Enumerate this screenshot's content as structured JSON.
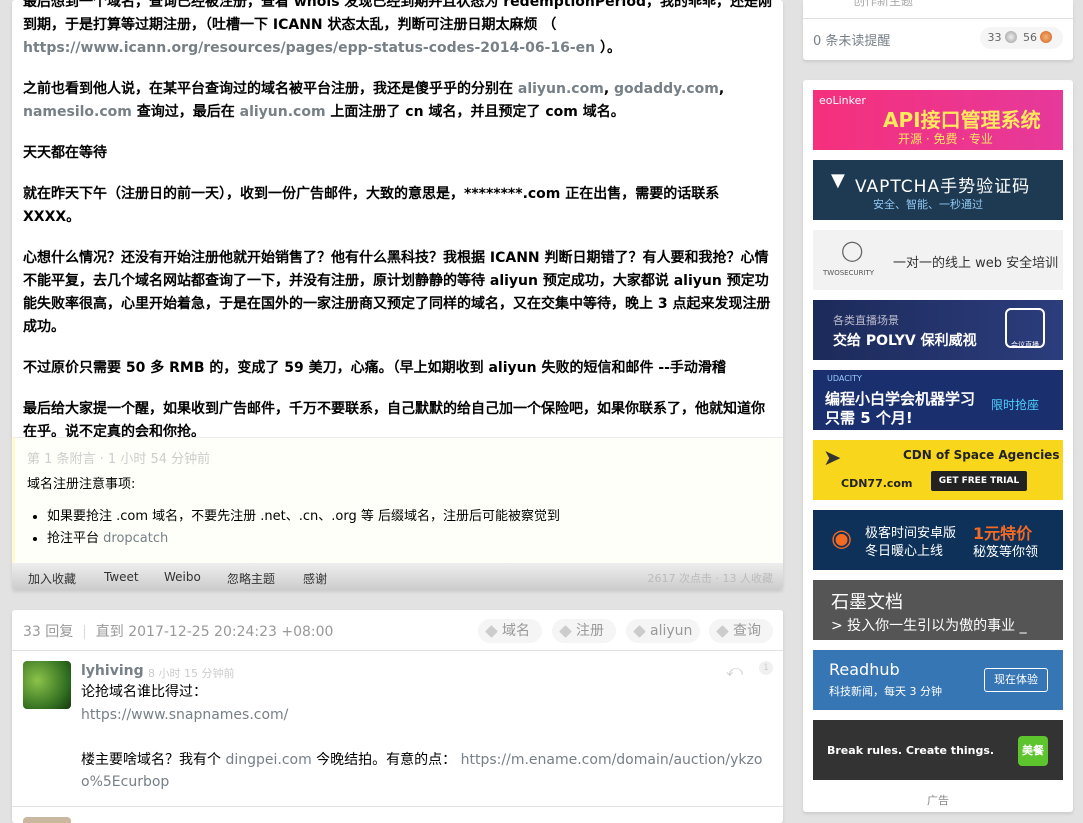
{
  "topic": {
    "paragraphs": [
      {
        "segments": [
          {
            "t": "最后想到一个域名，查询已经被注册，查看 whois 发现已经到期并且状态为 redemptionPeriod，我的乖乖，还是刚到期，于是打算等过期注册，（吐槽一下 ICANN 状态太乱，判断可注册日期太麻烦 （ "
          },
          {
            "t": "https://www.icann.org/resources/pages/epp-status-codes-2014-06-16-en",
            "link": true
          },
          {
            "t": " ）。"
          }
        ]
      },
      {
        "segments": [
          {
            "t": "之前也看到他人说，在某平台查询过的域名被平台注册，我还是傻乎乎的分别在 "
          },
          {
            "t": "aliyun.com",
            "link": true
          },
          {
            "t": ", "
          },
          {
            "t": "godaddy.com",
            "link": true
          },
          {
            "t": ", "
          },
          {
            "t": "namesilo.com",
            "link": true
          },
          {
            "t": " 查询过，最后在 "
          },
          {
            "t": "aliyun.com",
            "link": true
          },
          {
            "t": " 上面注册了 cn 域名，并且预定了 com 域名。"
          }
        ]
      },
      {
        "segments": [
          {
            "t": "天天都在等待"
          }
        ]
      },
      {
        "segments": [
          {
            "t": "就在昨天下午（注册日的前一天），收到一份广告邮件，大致的意思是，********.com 正在出售，需要的话联系 XXXX。"
          }
        ]
      },
      {
        "segments": [
          {
            "t": "心想什么情况？还没有开始注册他就开始销售了？他有什么黑科技？我根据 ICANN 判断日期错了？有人要和我抢？心情不能平复，去几个域名网站都查询了一下，并没有注册，原计划静静的等待 aliyun 预定成功，大家都说 aliyun 预定功能失败率很高，心里开始着急，于是在国外的一家注册商又预定了同样的域名，又在交集中等待，晚上 3 点起来发现注册成功。"
          }
        ]
      },
      {
        "segments": [
          {
            "t": "不过原价只需要 50 多 RMB 的，变成了 59 美刀，心痛。（早上如期收到 aliyun 失败的短信和邮件 --手动滑稽"
          }
        ]
      },
      {
        "segments": [
          {
            "t": "最后给大家提一个醒，如果收到广告邮件，千万不要联系，自己默默的给自己加一个保险吧，如果你联系了，他就知道你在乎。说不定真的会和你抢。"
          }
        ]
      }
    ],
    "append": {
      "header": "第 1 条附言  ·  1 小时 54 分钟前",
      "title": "域名注册注意事项:",
      "item1": "如果要抢注 .com 域名，不要先注册 .net、.cn、.org 等 后缀域名，注册后可能被察觉到",
      "item2_prefix": "抢注平台 ",
      "item2_link": "dropcatch"
    },
    "buttons": {
      "fav": "加入收藏",
      "tweet": "Tweet",
      "weibo": "Weibo",
      "ignore": "忽略主题",
      "thank": "感谢",
      "stats": "2617 次点击  ·  13 人收藏"
    }
  },
  "replies_header": {
    "count": "33 回复",
    "sep": "|",
    "until": "直到 2017-12-25 20:24:23 +08:00",
    "tags": [
      "域名",
      "注册",
      "aliyun",
      "查询"
    ]
  },
  "reply1": {
    "name": "lyhiving",
    "time": "8 小时 15 分钟前",
    "no": "1",
    "line1": "论抢域名谁比得过：",
    "link1": "https://www.snapnames.com/",
    "line3_prefix": "楼主要啥域名？我有个 ",
    "line3_link": "dingpei.com",
    "line3_mid": " 今晚结拍。有意的点： ",
    "line3_url": "https://m.ename.com/domain/auction/ykzoo%5Ecurbop"
  },
  "sidebar": {
    "top_partial": "创作新主题",
    "unread": "0 条未读提醒",
    "silver": "33",
    "bronze": "56",
    "ads_label": "广告",
    "colors": {
      "link": "#778087",
      "bg": "#e2e2e2"
    },
    "ads": [
      {
        "brand": "eoLinker",
        "title": "API接口管理系统",
        "sub": "开源 · 免费 · 专业"
      },
      {
        "title": "VAPTCHA手势验证码",
        "sub": "安全、智能、一秒通过"
      },
      {
        "brand": "TWOSECURITY",
        "title": "一对一的线上 web 安全培训"
      },
      {
        "sub": "各类直播场景",
        "title": "交给 POLYV 保利威视",
        "btn": "会议直播"
      },
      {
        "brand": "UDACITY",
        "title": "编程小白学会机器学习",
        "sub": "只需 5 个月!",
        "btn": "限时抢座"
      },
      {
        "title": "CDN of Space Agencies",
        "brand": "CDN77.com",
        "btn": "GET FREE TRIAL"
      },
      {
        "title": "极客时间安卓版",
        "sub": "冬日暖心上线",
        "btn_title": "1元特价",
        "btn_sub": "秘笈等你领"
      },
      {
        "title": "石墨文档",
        "sub": "> 投入你一生引以为傲的事业 _"
      },
      {
        "title": "Readhub",
        "sub": "科技新闻，每天 3 分钟",
        "btn": "现在体验"
      },
      {
        "title": "Break rules. Create things.",
        "btn": "美餐"
      }
    ]
  }
}
